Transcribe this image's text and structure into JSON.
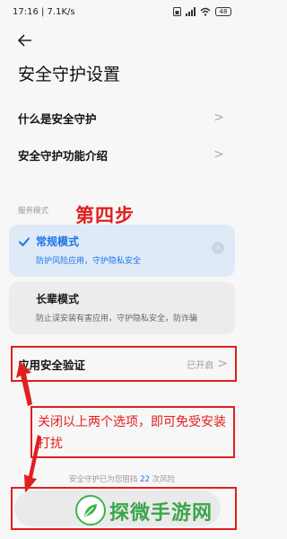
{
  "status_bar": {
    "time_speed": "17:16 | 7.1K/s",
    "battery": "48",
    "icons": [
      "sim-icon",
      "signal-icon",
      "wifi-icon",
      "battery-icon"
    ]
  },
  "header": {
    "back_icon": "back-arrow-icon",
    "title": "安全守护设置"
  },
  "menu": [
    {
      "label": "什么是安全守护"
    },
    {
      "label": "安全守护功能介绍"
    }
  ],
  "service_mode": {
    "section_label": "服务模式",
    "options": [
      {
        "title": "常规模式",
        "desc": "防护风险应用，守护隐私安全",
        "selected": true
      },
      {
        "title": "长辈模式",
        "desc": "防止误安装有害应用，守护隐私安全，防诈骗",
        "selected": false
      }
    ]
  },
  "app_verify": {
    "label": "应用安全验证",
    "status": "已开启"
  },
  "annotations": {
    "step": "第四步",
    "note": "关闭以上两个选项，即可免受安装打扰",
    "color": "#e01f1f"
  },
  "risk_stats": {
    "prefix": "安全守护已为您阻挡",
    "count": "22",
    "suffix": "次风险"
  },
  "watermark": {
    "text": "探微手游网"
  },
  "colors": {
    "accent": "#1a73e8",
    "selected_bg": "#dfeaf8",
    "annotation": "#e01f1f",
    "watermark": "#3aa64a"
  }
}
